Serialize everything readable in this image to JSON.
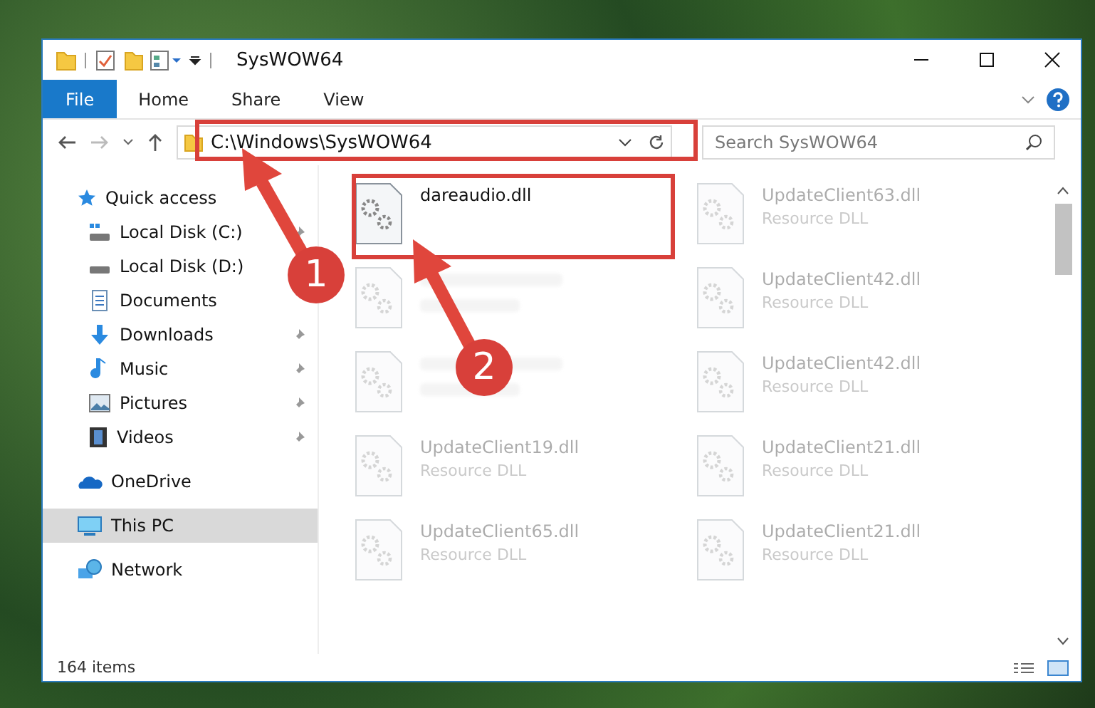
{
  "window": {
    "title": "SysWOW64"
  },
  "ribbon": {
    "tabs": [
      {
        "label": "File",
        "selected": true
      },
      {
        "label": "Home",
        "selected": false
      },
      {
        "label": "Share",
        "selected": false
      },
      {
        "label": "View",
        "selected": false
      }
    ]
  },
  "address": {
    "path": "C:\\Windows\\SysWOW64"
  },
  "search": {
    "placeholder": "Search SysWOW64"
  },
  "sidebar": {
    "items": [
      {
        "label": "Quick access",
        "kind": "star",
        "selected": false,
        "children": [
          {
            "label": "Local Disk (C:)",
            "kind": "drive-windows",
            "pinned": true,
            "selected": false
          },
          {
            "label": "Local Disk (D:)",
            "kind": "drive",
            "pinned": false,
            "selected": false
          },
          {
            "label": "Documents",
            "kind": "documents",
            "pinned": false,
            "selected": false
          },
          {
            "label": "Downloads",
            "kind": "downloads",
            "pinned": true,
            "selected": false
          },
          {
            "label": "Music",
            "kind": "music",
            "pinned": true,
            "selected": false
          },
          {
            "label": "Pictures",
            "kind": "pictures",
            "pinned": true,
            "selected": false
          },
          {
            "label": "Videos",
            "kind": "videos",
            "pinned": true,
            "selected": false
          }
        ]
      },
      {
        "label": "OneDrive",
        "kind": "cloud",
        "selected": false
      },
      {
        "label": "This PC",
        "kind": "pc",
        "selected": true
      },
      {
        "label": "Network",
        "kind": "network",
        "selected": false
      }
    ]
  },
  "files": [
    {
      "name": "dareaudio.dll",
      "blurred": false
    },
    {
      "name": "UpdateClient63.dll",
      "type": "Resource DLL",
      "blurred": true
    },
    {
      "blurred": true
    },
    {
      "name": "UpdateClient42.dll",
      "type": "Resource DLL",
      "blurred": true
    },
    {
      "blurred": true
    },
    {
      "name": "UpdateClient42.dll",
      "type": "Resource DLL",
      "blurred": true
    },
    {
      "name": "UpdateClient19.dll",
      "type": "Resource DLL",
      "blurred": true
    },
    {
      "name": "UpdateClient21.dll",
      "type": "Resource DLL",
      "blurred": true
    },
    {
      "name": "UpdateClient65.dll",
      "type": "Resource DLL",
      "blurred": true
    },
    {
      "name": "UpdateClient21.dll",
      "type": "Resource DLL",
      "blurred": true
    }
  ],
  "status_bar": {
    "count": "164 items"
  },
  "annotations": [
    {
      "label": "1"
    },
    {
      "label": "2"
    }
  ]
}
